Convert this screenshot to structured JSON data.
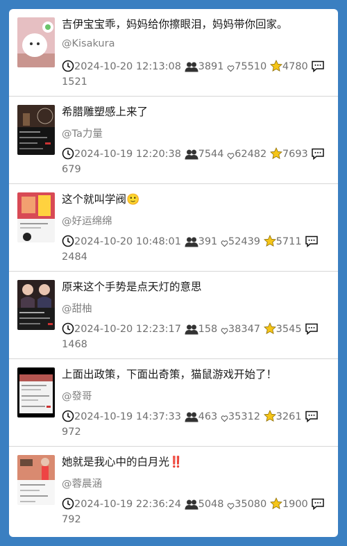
{
  "posts": [
    {
      "title": "吉伊宝宝乖，妈妈给你擦眼泪，妈妈带你回家。",
      "author": "@Kisakura",
      "time": "2024-10-20 12:13:08",
      "users": "3891",
      "likes": "75510",
      "stars": "4780",
      "comments": "1521"
    },
    {
      "title": "希腊雕塑感上来了",
      "author": "@Ta力量",
      "time": "2024-10-19 12:20:38",
      "users": "7544",
      "likes": "62482",
      "stars": "7693",
      "comments": "679"
    },
    {
      "title": "这个就叫学阀🙂",
      "author": "@好运绵绵",
      "time": "2024-10-20 10:48:01",
      "users": "391",
      "likes": "52439",
      "stars": "5711",
      "comments": "2484"
    },
    {
      "title": "原来这个手势是点天灯的意思",
      "author": "@甜柚",
      "time": "2024-10-20 12:23:17",
      "users": "158",
      "likes": "38347",
      "stars": "3545",
      "comments": "1468"
    },
    {
      "title": "上面出政策，下面出奇策，猫鼠游戏开始了！",
      "author": "@發哥",
      "time": "2024-10-19 14:37:33",
      "users": "463",
      "likes": "35312",
      "stars": "3261",
      "comments": "972"
    },
    {
      "title": "她就是我心中的白月光‼️",
      "author": "@蓉晨涵",
      "time": "2024-10-19 22:36:24",
      "users": "5048",
      "likes": "35080",
      "stars": "1900",
      "comments": "792"
    }
  ],
  "colors": {
    "page_bg": "#3a7fc1",
    "card_bg": "#ffffff",
    "star": "#f5c518"
  },
  "icons": {
    "time": "clock-icon",
    "users": "users-icon",
    "likes": "heart-icon",
    "stars": "star-icon",
    "comments": "comment-icon"
  }
}
